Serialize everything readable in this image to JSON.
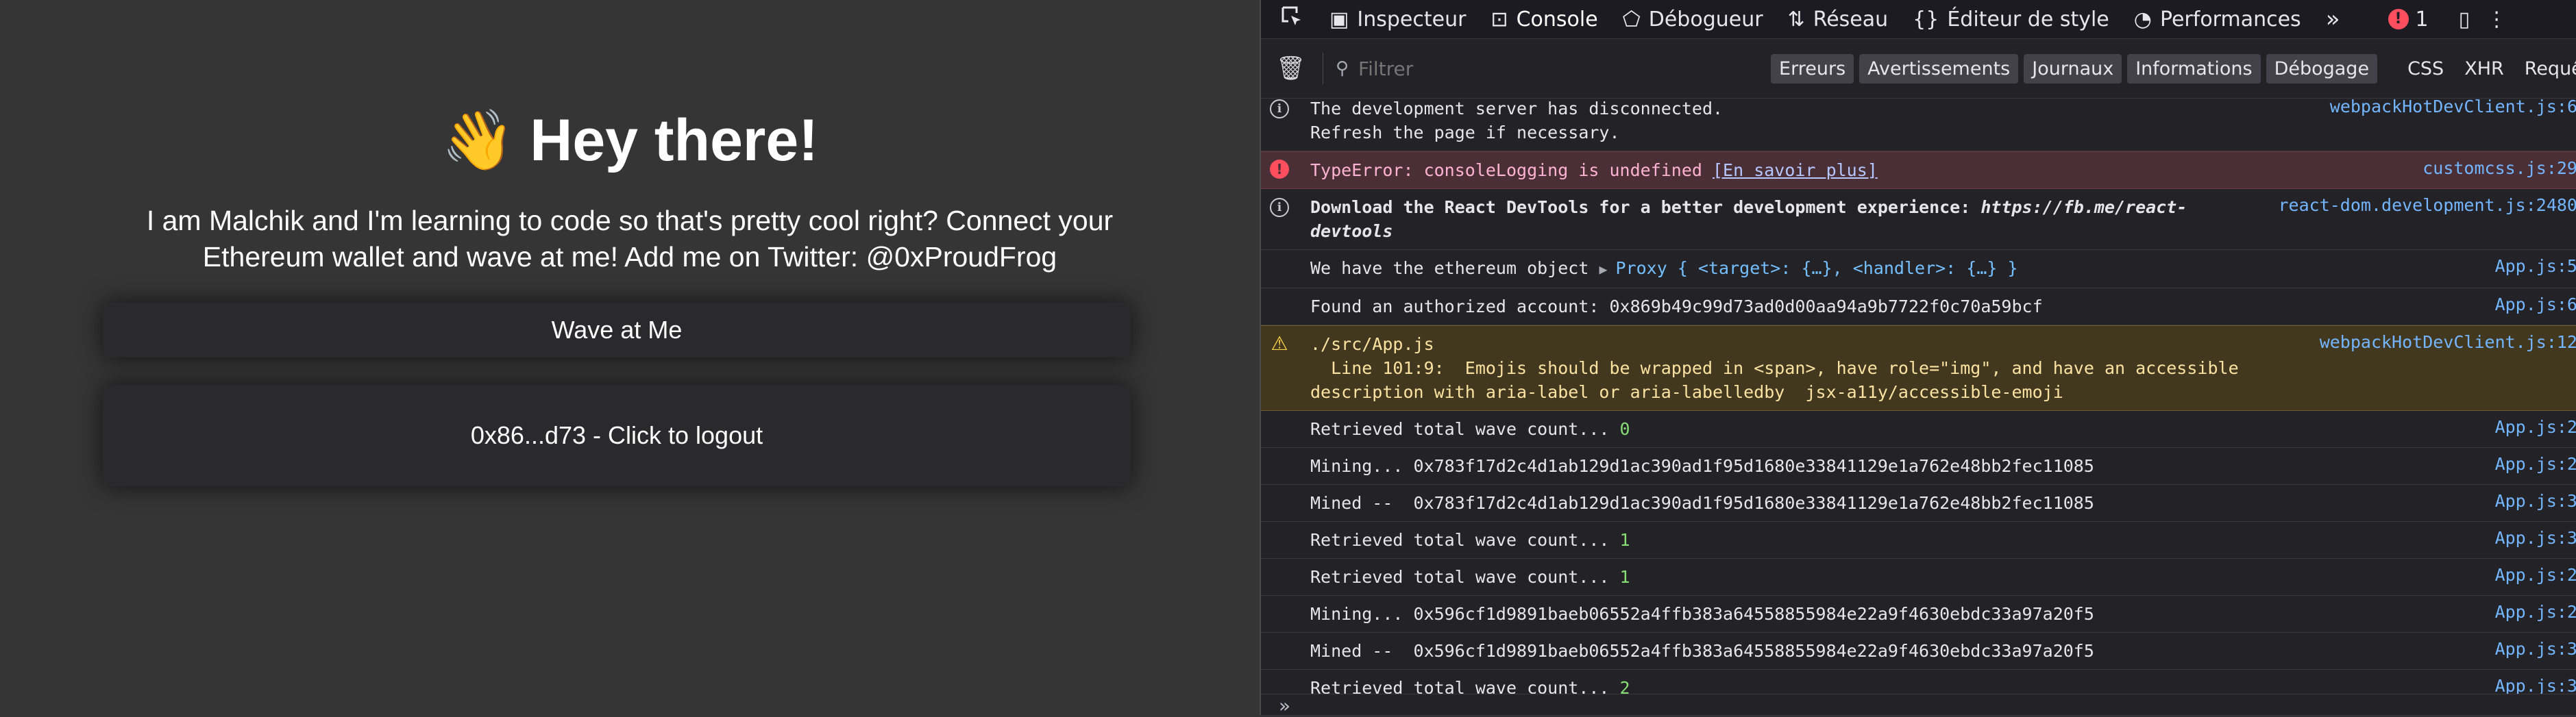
{
  "app": {
    "emoji": "👋",
    "title": "Hey there!",
    "description": "I am Malchik and I'm learning to code so that's pretty cool right? Connect your Ethereum wallet and wave at me! Add me on Twitter: @0xProudFrog",
    "wave_button": "Wave at Me",
    "logout_button": "0x86...d73 - Click to logout"
  },
  "devtools": {
    "tabs": [
      {
        "label": "Inspecteur",
        "icon": "inspector-icon"
      },
      {
        "label": "Console",
        "icon": "console-icon",
        "active": true
      },
      {
        "label": "Débogueur",
        "icon": "debugger-icon"
      },
      {
        "label": "Réseau",
        "icon": "network-icon"
      },
      {
        "label": "Éditeur de style",
        "icon": "style-editor-icon"
      },
      {
        "label": "Performances",
        "icon": "performance-icon"
      }
    ],
    "error_count": "1",
    "filter_placeholder": "Filtrer",
    "level_chips": [
      "Erreurs",
      "Avertissements",
      "Journaux",
      "Informations",
      "Débogage"
    ],
    "type_filters": [
      "CSS",
      "XHR",
      "Requêtes"
    ],
    "messages": [
      {
        "type": "info",
        "text": "The development server has disconnected.\nRefresh the page if necessary.",
        "source": "webpackHotDevClient.js:6"
      },
      {
        "type": "error",
        "text": "TypeError: consoleLogging is undefined ",
        "link": "[En savoir plus]",
        "source": "customcss.js:29"
      },
      {
        "type": "info",
        "bold": "Download the React DevTools for a better development experience: ",
        "italic": "https://fb.me/react-\ndevtools",
        "source": "react-dom.development.js:2480"
      },
      {
        "type": "log",
        "text": "We have the ethereum object ",
        "proxy": "Proxy { <target>: {…}, <handler>: {…} }",
        "source": "App.js:5"
      },
      {
        "type": "log",
        "text": "Found an authorized account: 0x869b49c99d73ad0d00aa94a9b7722f0c70a59bcf",
        "source": "App.js:6"
      },
      {
        "type": "warn",
        "text": "./src/App.js\n  Line 101:9:  Emojis should be wrapped in <span>, have role=\"img\", and have an accessible\ndescription with aria-label or aria-labelledby  jsx-a11y/accessible-emoji",
        "source": "webpackHotDevClient.js:12"
      },
      {
        "type": "log",
        "text": "Retrieved total wave count... ",
        "num": "0",
        "source": "App.js:2"
      },
      {
        "type": "log",
        "text": "Mining... 0x783f17d2c4d1ab129d1ac390ad1f95d1680e33841129e1a762e48bb2fec11085",
        "source": "App.js:2"
      },
      {
        "type": "log",
        "text": "Mined --  0x783f17d2c4d1ab129d1ac390ad1f95d1680e33841129e1a762e48bb2fec11085",
        "source": "App.js:3"
      },
      {
        "type": "log",
        "text": "Retrieved total wave count... ",
        "num": "1",
        "source": "App.js:3"
      },
      {
        "type": "log",
        "text": "Retrieved total wave count... ",
        "num": "1",
        "source": "App.js:2"
      },
      {
        "type": "log",
        "text": "Mining... 0x596cf1d9891baeb06552a4ffb383a64558855984e22a9f4630ebdc33a97a20f5",
        "source": "App.js:2"
      },
      {
        "type": "log",
        "text": "Mined --  0x596cf1d9891baeb06552a4ffb383a64558855984e22a9f4630ebdc33a97a20f5",
        "source": "App.js:3"
      },
      {
        "type": "log",
        "text": "Retrieved total wave count... ",
        "num": "2",
        "source": "App.js:3"
      }
    ],
    "prompt": "»"
  }
}
